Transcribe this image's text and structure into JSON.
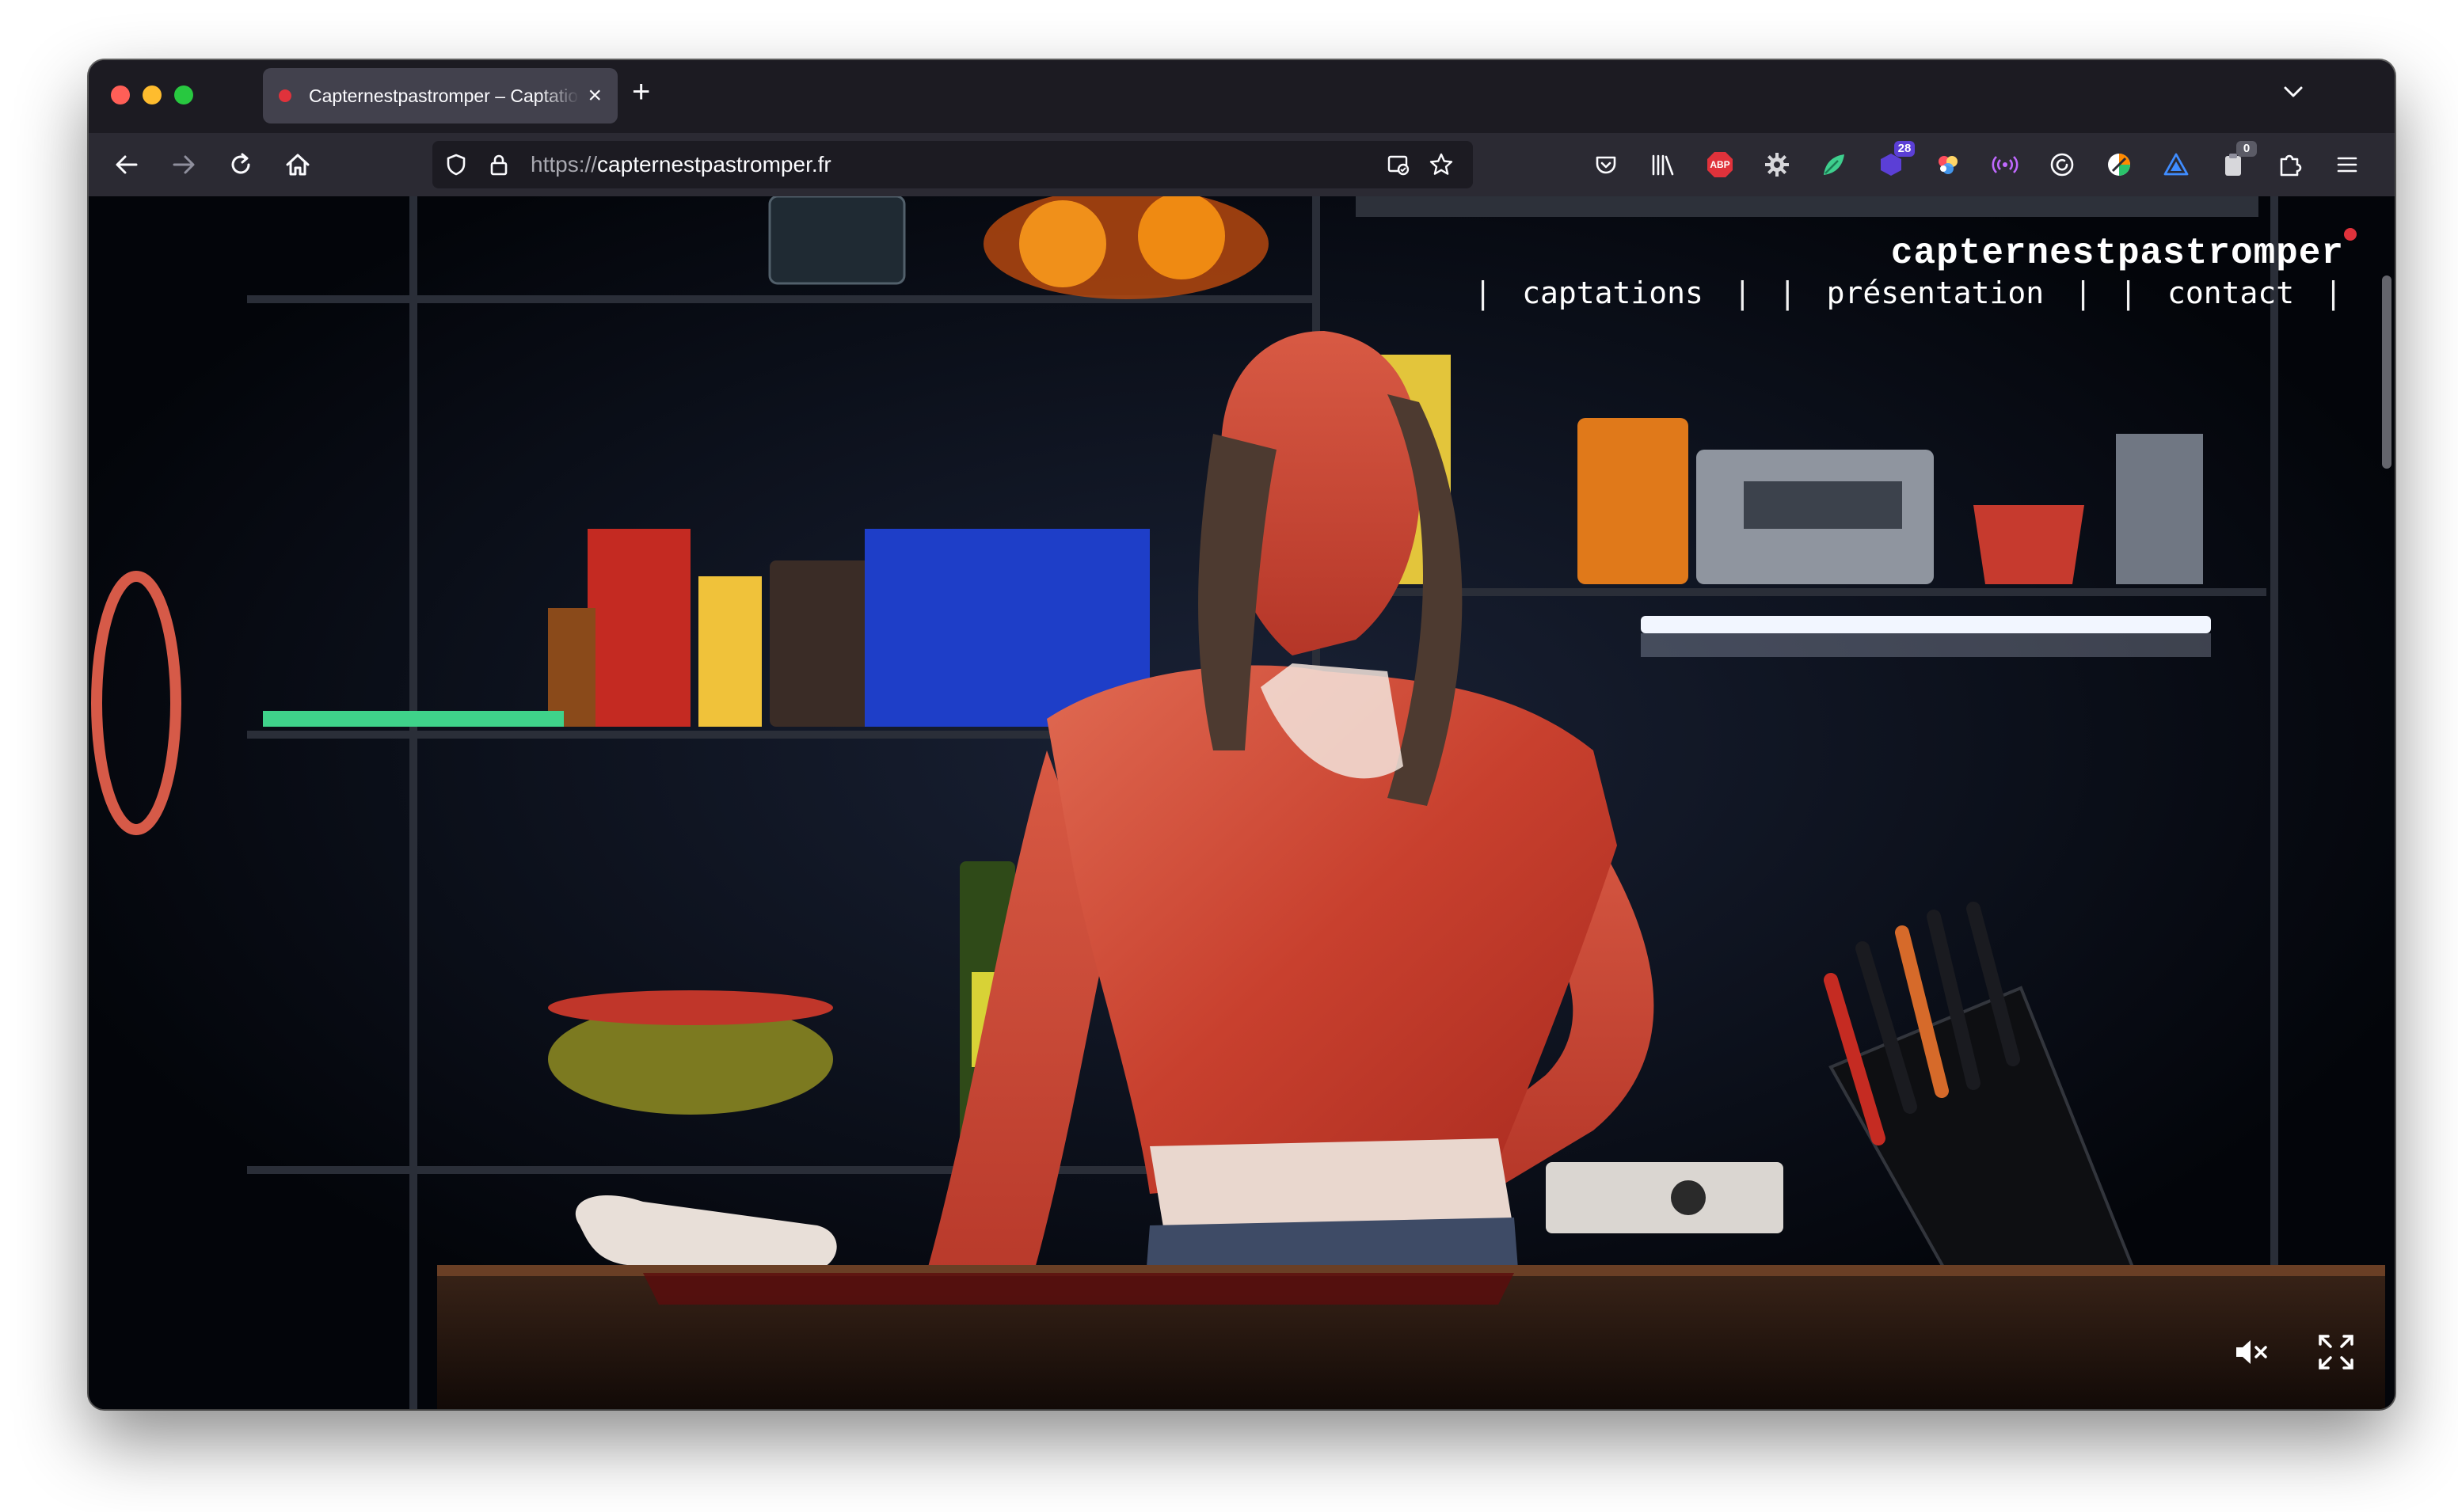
{
  "browser": {
    "tab": {
      "title": "Capternestpastromper – Captations"
    },
    "url": {
      "scheme": "https://",
      "host": "capternestpastromper.fr"
    },
    "extensions": [
      {
        "name": "pocket-icon"
      },
      {
        "name": "library-icon"
      },
      {
        "name": "adblock-plus-icon",
        "label": "ABP"
      },
      {
        "name": "gear-icon"
      },
      {
        "name": "leaf-extension-icon"
      },
      {
        "name": "counter-extension-icon",
        "badge": "28"
      },
      {
        "name": "color-dots-icon"
      },
      {
        "name": "broadcast-icon"
      },
      {
        "name": "refresh-circle-icon"
      },
      {
        "name": "pie-extension-icon"
      },
      {
        "name": "triangle-extension-icon"
      },
      {
        "name": "clipboard-extension-icon",
        "badge": "0"
      },
      {
        "name": "puzzle-icon"
      },
      {
        "name": "hamburger-menu-icon"
      }
    ]
  },
  "site": {
    "title": "capternestpastromper",
    "nav": [
      {
        "label": "captations"
      },
      {
        "label": "présentation"
      },
      {
        "label": "contact"
      }
    ]
  },
  "colors": {
    "accent_red": "#e0323b",
    "browser_bg": "#1c1b22",
    "toolbar_bg": "#2b2a33",
    "page_bg": "#05070c"
  }
}
